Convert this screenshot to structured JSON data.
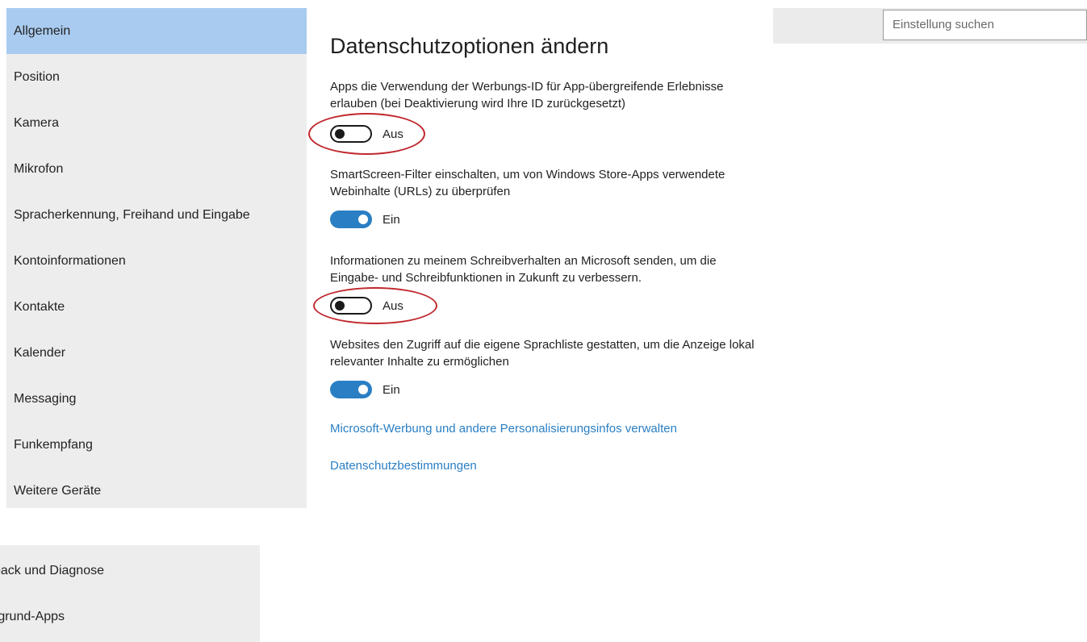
{
  "search": {
    "placeholder": "Einstellung suchen"
  },
  "sidebar": {
    "items": [
      {
        "label": "Allgemein",
        "selected": true
      },
      {
        "label": "Position"
      },
      {
        "label": "Kamera"
      },
      {
        "label": "Mikrofon"
      },
      {
        "label": "Spracherkennung, Freihand und Eingabe"
      },
      {
        "label": "Kontoinformationen"
      },
      {
        "label": "Kontakte"
      },
      {
        "label": "Kalender"
      },
      {
        "label": "Messaging"
      },
      {
        "label": "Funkempfang"
      },
      {
        "label": "Weitere Geräte"
      }
    ],
    "lower_items": [
      {
        "label": "back und Diagnose"
      },
      {
        "label": "rgrund-Apps"
      }
    ]
  },
  "main": {
    "title": "Datenschutzoptionen ändern",
    "settings": [
      {
        "description": "Apps die Verwendung der Werbungs-ID für App-übergreifende Erlebnisse erlauben (bei Deaktivierung wird Ihre ID zurückgesetzt)",
        "state": "off",
        "state_label": "Aus"
      },
      {
        "description": "SmartScreen-Filter einschalten, um von Windows Store-Apps verwendete Webinhalte (URLs) zu überprüfen",
        "state": "on",
        "state_label": "Ein"
      },
      {
        "description": "Informationen zu meinem Schreibverhalten an Microsoft senden, um die Eingabe- und Schreibfunktionen in Zukunft zu verbessern.",
        "state": "off",
        "state_label": "Aus"
      },
      {
        "description": "Websites den Zugriff auf die eigene Sprachliste gestatten, um die Anzeige lokal relevanter Inhalte zu ermöglichen",
        "state": "on",
        "state_label": "Ein"
      }
    ],
    "links": {
      "ads": "Microsoft-Werbung und andere Personalisierungsinfos verwalten",
      "privacy": "Datenschutzbestimmungen"
    }
  },
  "colors": {
    "accent": "#2a7fc4",
    "selected_nav": "#a9cbef",
    "sidebar_bg": "#ededed",
    "annotation_red": "#c0272d"
  }
}
